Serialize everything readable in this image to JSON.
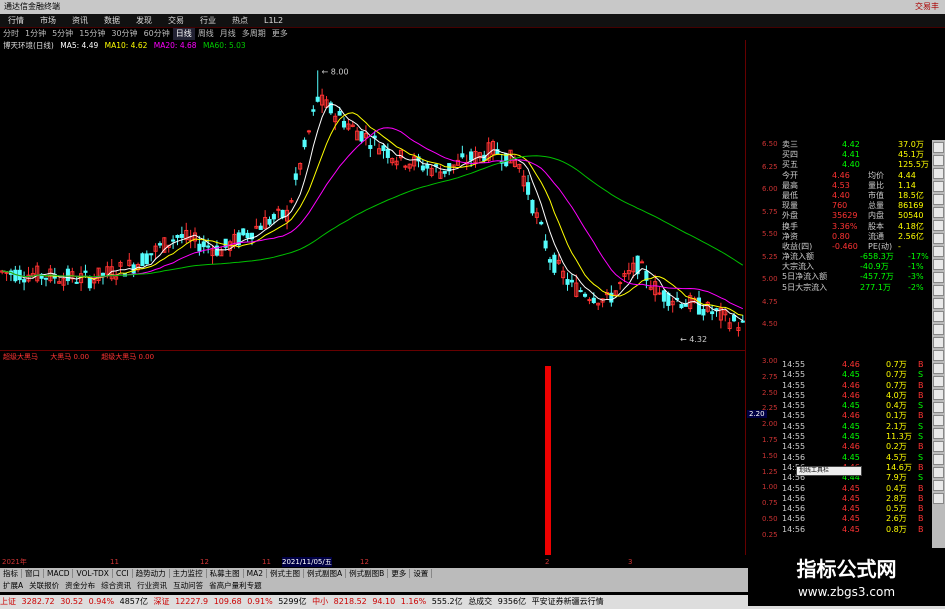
{
  "window": {
    "title": "通达信金融终端",
    "right": "交易丰"
  },
  "menu": [
    "行情",
    "市场",
    "资讯",
    "数据",
    "发现",
    "交易",
    "行业",
    "热点",
    "L1L2"
  ],
  "periods": {
    "items": [
      "分时",
      "1分钟",
      "5分钟",
      "15分钟",
      "30分钟",
      "60分钟",
      "日线",
      "周线",
      "月线",
      "多周期",
      "更多"
    ],
    "active": "日线"
  },
  "stock": {
    "name": "博天环境(日线)",
    "ma5": "MA5: 4.49",
    "ma10": "MA10: 4.62",
    "ma20": "MA20: 4.68",
    "ma60": "MA60: 5.03"
  },
  "price_axis": [
    "6.50",
    "6.25",
    "6.00",
    "5.75",
    "5.50",
    "5.25",
    "5.00",
    "4.75",
    "4.50"
  ],
  "annotations": {
    "high": "8.00",
    "low": "4.32"
  },
  "indicator": {
    "name": "超级大黑马",
    "line1": "大黑马 0.00",
    "line2": "超级大黑马 0.00",
    "axis": [
      "3.00",
      "2.75",
      "2.50",
      "2.25",
      "2.00",
      "1.75",
      "1.50",
      "1.25",
      "1.00",
      "0.75",
      "0.50",
      "0.25"
    ],
    "cur": "2.20"
  },
  "order_book": [
    {
      "label": "卖三",
      "price": "4.42",
      "vol": "37.0万"
    },
    {
      "label": "买四",
      "price": "4.41",
      "vol": "45.1万"
    },
    {
      "label": "买五",
      "price": "4.40",
      "vol": "125.5万"
    }
  ],
  "stats": [
    {
      "l1": "今开",
      "v1": "4.46",
      "l2": "均价",
      "v2": "4.44"
    },
    {
      "l1": "最高",
      "v1": "4.53",
      "l2": "量比",
      "v2": "1.14"
    },
    {
      "l1": "最低",
      "v1": "4.40",
      "l2": "市值",
      "v2": "18.5亿"
    },
    {
      "l1": "现量",
      "v1": "760",
      "l2": "总量",
      "v2": "86169"
    },
    {
      "l1": "外盘",
      "v1": "35629",
      "l2": "内盘",
      "v2": "50540"
    },
    {
      "l1": "换手",
      "v1": "3.36%",
      "l2": "股本",
      "v2": "4.18亿"
    },
    {
      "l1": "净资",
      "v1": "0.80",
      "l2": "流通",
      "v2": "2.56亿"
    },
    {
      "l1": "收益(四)",
      "v1": "-0.460",
      "l2": "PE(动)",
      "v2": "-"
    }
  ],
  "flows": [
    {
      "l": "净流入额",
      "v": "-658.3万",
      "p": "-17%"
    },
    {
      "l": "大宗流入",
      "v": "-40.9万",
      "p": "-1%"
    },
    {
      "l": "5日净流入额",
      "v": "-457.7万",
      "p": "-3%"
    },
    {
      "l": "5日大宗流入",
      "v": "277.1万",
      "p": "-2%"
    }
  ],
  "trades": [
    [
      "14:55",
      "4.46",
      "0.7万",
      "B"
    ],
    [
      "14:55",
      "4.45",
      "0.7万",
      "S"
    ],
    [
      "14:55",
      "4.46",
      "0.7万",
      "B"
    ],
    [
      "14:55",
      "4.46",
      "4.0万",
      "B"
    ],
    [
      "14:55",
      "4.45",
      "0.4万",
      "S"
    ],
    [
      "14:55",
      "4.46",
      "0.1万",
      "B"
    ],
    [
      "14:55",
      "4.45",
      "2.1万",
      "S"
    ],
    [
      "14:55",
      "4.45",
      "11.3万",
      "S"
    ],
    [
      "14:55",
      "4.46",
      "0.2万",
      "B"
    ],
    [
      "14:56",
      "4.45",
      "4.5万",
      "S"
    ],
    [
      "14:56",
      "4.46",
      "14.6万",
      "B"
    ],
    [
      "14:56",
      "4.44",
      "7.9万",
      "S"
    ],
    [
      "14:56",
      "4.45",
      "0.4万",
      "B"
    ],
    [
      "14:56",
      "4.45",
      "2.8万",
      "B"
    ],
    [
      "14:56",
      "4.45",
      "0.5万",
      "B"
    ],
    [
      "14:56",
      "4.45",
      "2.6万",
      "B"
    ],
    [
      "14:56",
      "4.45",
      "0.8万",
      "B"
    ]
  ],
  "xaxis": [
    "2021年",
    "11",
    "12",
    "11",
    "2021/11/05/五",
    "12",
    "2",
    "3"
  ],
  "tabs": [
    "指标",
    "窗口",
    "MACD",
    "VOL-TDX",
    "CCI",
    "趋势动力",
    "主力监控",
    "私募主图",
    "MA2",
    "例式主图",
    "例式副图A",
    "例式副图B",
    "更多",
    "设置"
  ],
  "tabs2": [
    "扩展A",
    "关联报价",
    "资金分布",
    "综合资讯",
    "行业资讯",
    "互动问答",
    "省高户量利专题"
  ],
  "status": {
    "sh_lbl": "上证",
    "sh": "3282.72",
    "sh_c": "30.52",
    "sh_p": "0.94%",
    "sh_v": "4857亿",
    "sz_lbl": "深证",
    "sz": "12227.9",
    "sz_c": "109.68",
    "sz_p": "0.91%",
    "sz_v": "5299亿",
    "zx_lbl": "中小",
    "zx": "8218.52",
    "zx_c": "94.10",
    "zx_p": "1.16%",
    "zx_v": "555.2亿",
    "tot_lbl": "总成交",
    "tot": "9356亿",
    "news": "平安证券新疆云行情"
  },
  "watermark": {
    "title": "指标公式网",
    "url": "www.zbgs3.com"
  },
  "popup": "划线工具栏",
  "colors": {
    "up": "#ff3232",
    "down": "#54fcfc",
    "ma5": "#ffffff",
    "ma10": "#ffff00",
    "ma20": "#ff00ff",
    "ma60": "#00c000"
  }
}
